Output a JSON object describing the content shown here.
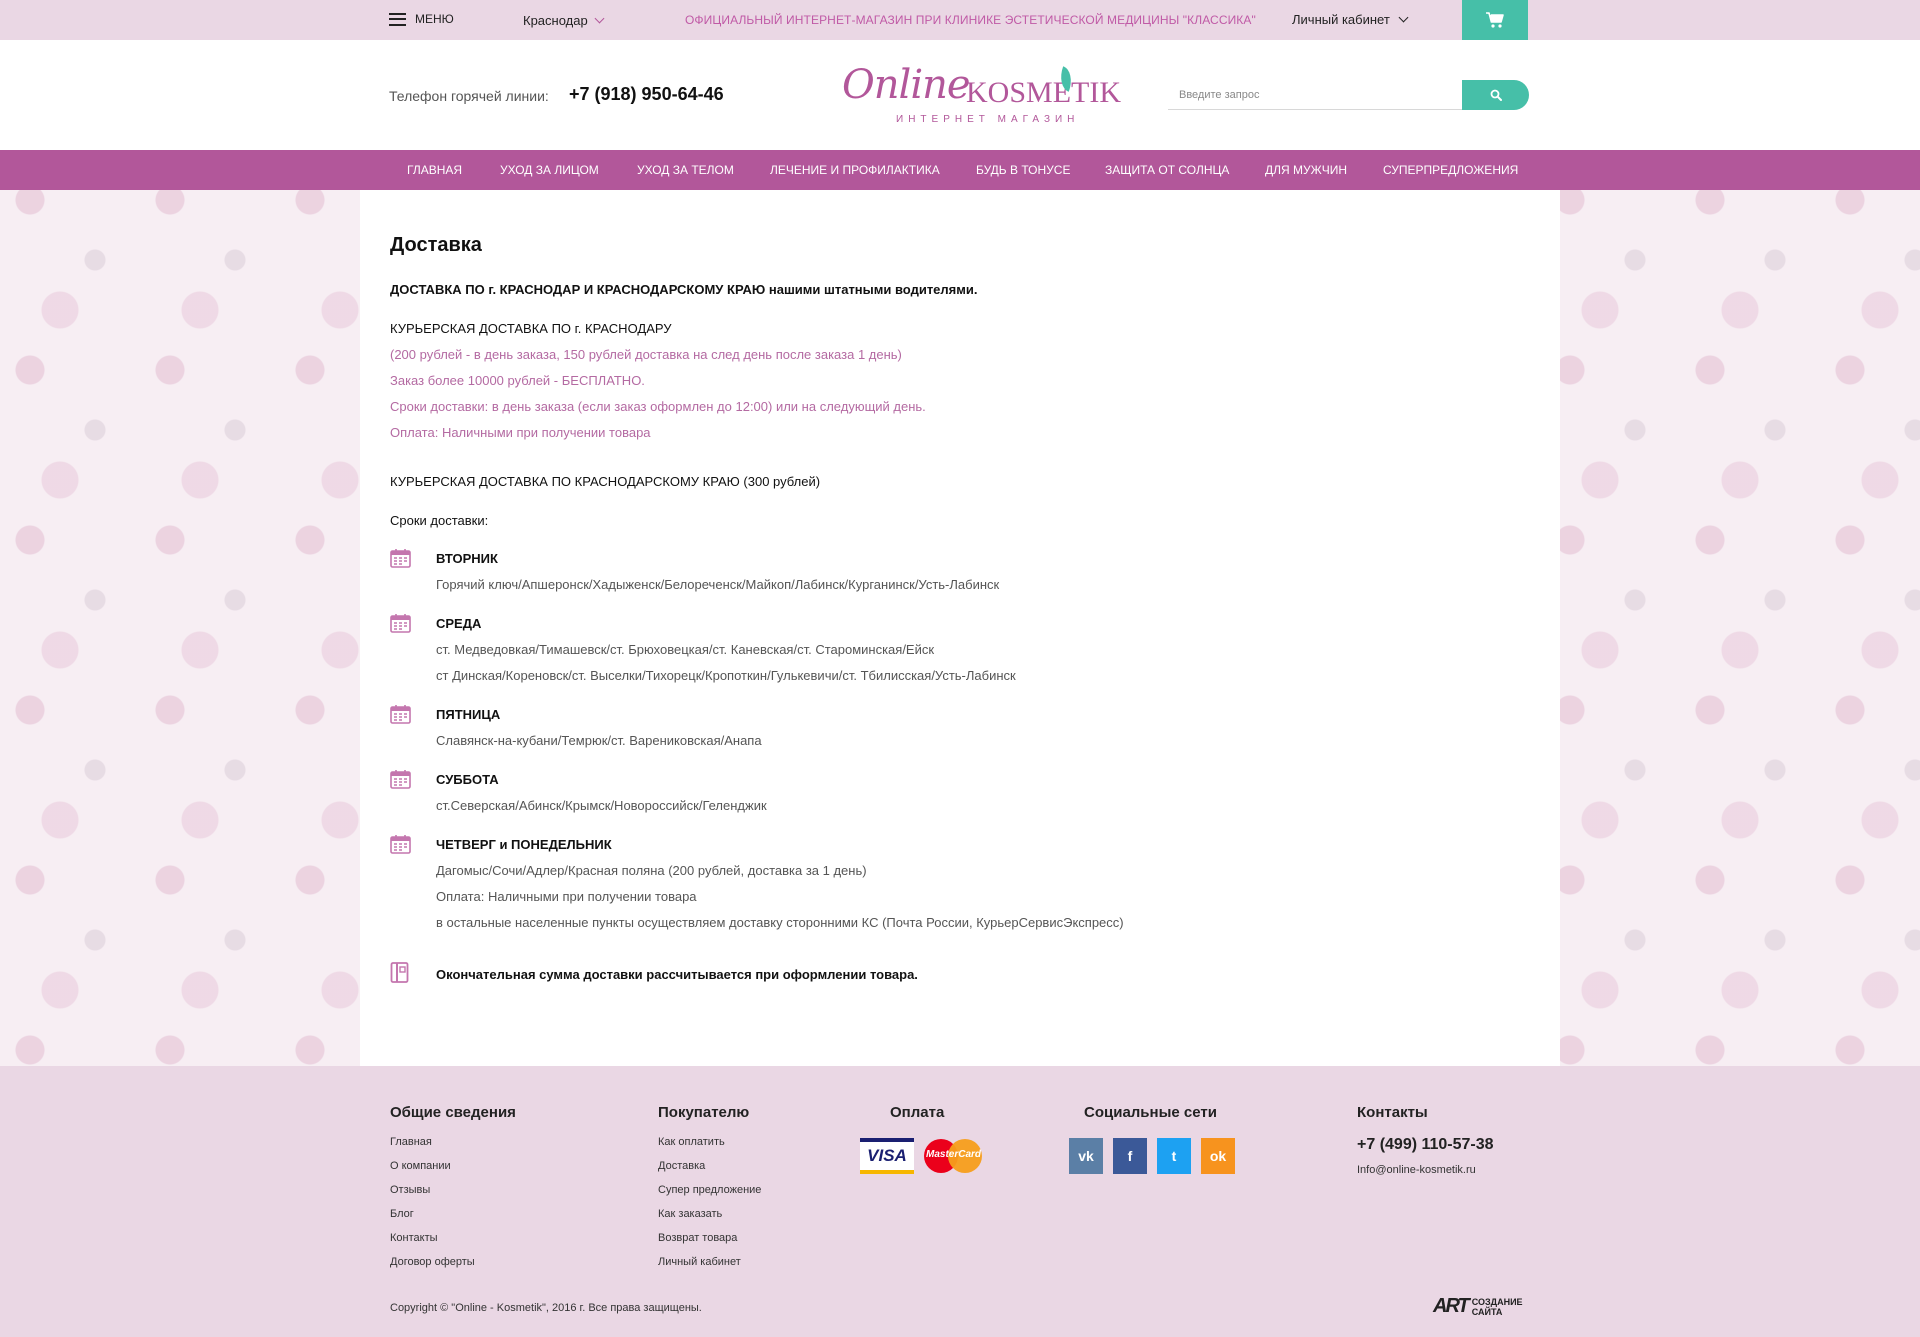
{
  "topbar": {
    "menu_label": "МЕНЮ",
    "city": "Краснодар",
    "promo": "ОФИЦИАЛЬНЫЙ ИНТЕРНЕТ-МАГАЗИН ПРИ КЛИНИКЕ ЭСТЕТИЧЕСКОЙ МЕДИЦИНЫ \"КЛАССИКА\"",
    "account": "Личный кабинет",
    "cart_icon": "cart-icon"
  },
  "header": {
    "hotline_label": "Телефон горячей линии:",
    "hotline_phone": "+7 (918) 950-64-46",
    "logo_script": "Online",
    "logo_brand": "KOSMETIK",
    "logo_sub": "ИНТЕРНЕТ МАГАЗИН",
    "search_placeholder": "Введите запрос"
  },
  "nav": {
    "items": [
      "ГЛАВНАЯ",
      "УХОД ЗА ЛИЦОМ",
      "УХОД ЗА ТЕЛОМ",
      "ЛЕЧЕНИЕ И ПРОФИЛАКТИКА",
      "БУДЬ В ТОНУСЕ",
      "ЗАЩИТА ОТ СОЛНЦА",
      "ДЛЯ МУЖЧИН",
      "СУПЕРПРЕДЛОЖЕНИЯ"
    ]
  },
  "content": {
    "title": "Доставка",
    "intro": "ДОСТАВКА ПО г. КРАСНОДАР И КРАСНОДАРСКОМУ КРАЮ нашими штатными водителями.",
    "city_delivery": {
      "heading": "КУРЬЕРСКАЯ ДОСТАВКА ПО г. КРАСНОДАРУ",
      "lines": [
        "(200 рублей - в день заказа, 150 рублей доставка на след день после заказа 1 день)",
        "Заказ более 10000 рублей - БЕСПЛАТНО.",
        "Сроки доставки: в день заказа (если заказ оформлен до 12:00) или на следующий день.",
        "Оплата: Наличными при получении товара"
      ]
    },
    "region_heading": "КУРЬЕРСКАЯ ДОСТАВКА ПО КРАСНОДАРСКОМУ КРАЮ (300 рублей)",
    "schedule_label": "Сроки доставки:",
    "schedule": [
      {
        "day": "ВТОРНИК",
        "lines": [
          "Горячий ключ/Апшеронск/Хадыженск/Белореченск/Майкоп/Лабинск/Курганинск/Усть-Лабинск"
        ]
      },
      {
        "day": "СРЕДА",
        "lines": [
          "ст. Медведовкая/Тимашевск/ст. Брюховецкая/ст. Каневская/ст. Староминская/Ейск",
          "ст Динская/Кореновск/ст. Выселки/Тихорецк/Кропоткин/Гулькевичи/ст. Тбилисская/Усть-Лабинск"
        ]
      },
      {
        "day": "ПЯТНИЦА",
        "lines": [
          "Славянск-на-кубани/Темрюк/ст. Варениковская/Анапа"
        ]
      },
      {
        "day": "СУББОТА",
        "lines": [
          "ст.Северская/Абинск/Крымск/Новороссийск/Геленджик"
        ]
      },
      {
        "day": "ЧЕТВЕРГ и ПОНЕДЕЛЬНИК",
        "lines": [
          "Дагомыс/Сочи/Адлер/Красная поляна (200 рублей, доставка за 1 день)",
          "Оплата: Наличными при получении товара",
          "в остальные населенные пункты осуществляем доставку сторонними КС (Почта России, КурьерСервисЭкспресс)"
        ]
      }
    ],
    "note": "Окончательная сумма доставки рассчитывается при оформлении товара."
  },
  "footer": {
    "general": {
      "title": "Общие сведения",
      "links": [
        "Главная",
        "О компании",
        "Отзывы",
        "Блог",
        "Контакты",
        "Договор оферты"
      ]
    },
    "buyer": {
      "title": "Покупателю",
      "links": [
        "Как оплатить",
        "Доставка",
        "Супер предложение",
        "Как заказать",
        "Возврат товара",
        "Личный кабинет"
      ]
    },
    "payment": {
      "title": "Оплата",
      "visa": "VISA",
      "mastercard": "MasterCard"
    },
    "social": {
      "title": "Социальные сети",
      "items": [
        {
          "name": "vk",
          "glyph": "vk",
          "color": "#5b7fa6"
        },
        {
          "name": "facebook",
          "glyph": "f",
          "color": "#3b5998"
        },
        {
          "name": "twitter",
          "glyph": "t",
          "color": "#1da1f2"
        },
        {
          "name": "odnoklassniki",
          "glyph": "ok",
          "color": "#f7931e"
        }
      ]
    },
    "contacts": {
      "title": "Контакты",
      "phone": "+7 (499) 110-57-38",
      "email": "Info@online-kosmetik.ru"
    },
    "copyright": "Copyright © \"Online - Kosmetik\", 2016 г.  Все права защищены.",
    "developer": {
      "mark": "ART",
      "line1": "СОЗДАНИЕ",
      "line2": "САЙТА"
    }
  },
  "colors": {
    "accent_pink": "#b2579a",
    "accent_teal": "#46bfa8",
    "topbar_bg": "#ead7e4"
  }
}
